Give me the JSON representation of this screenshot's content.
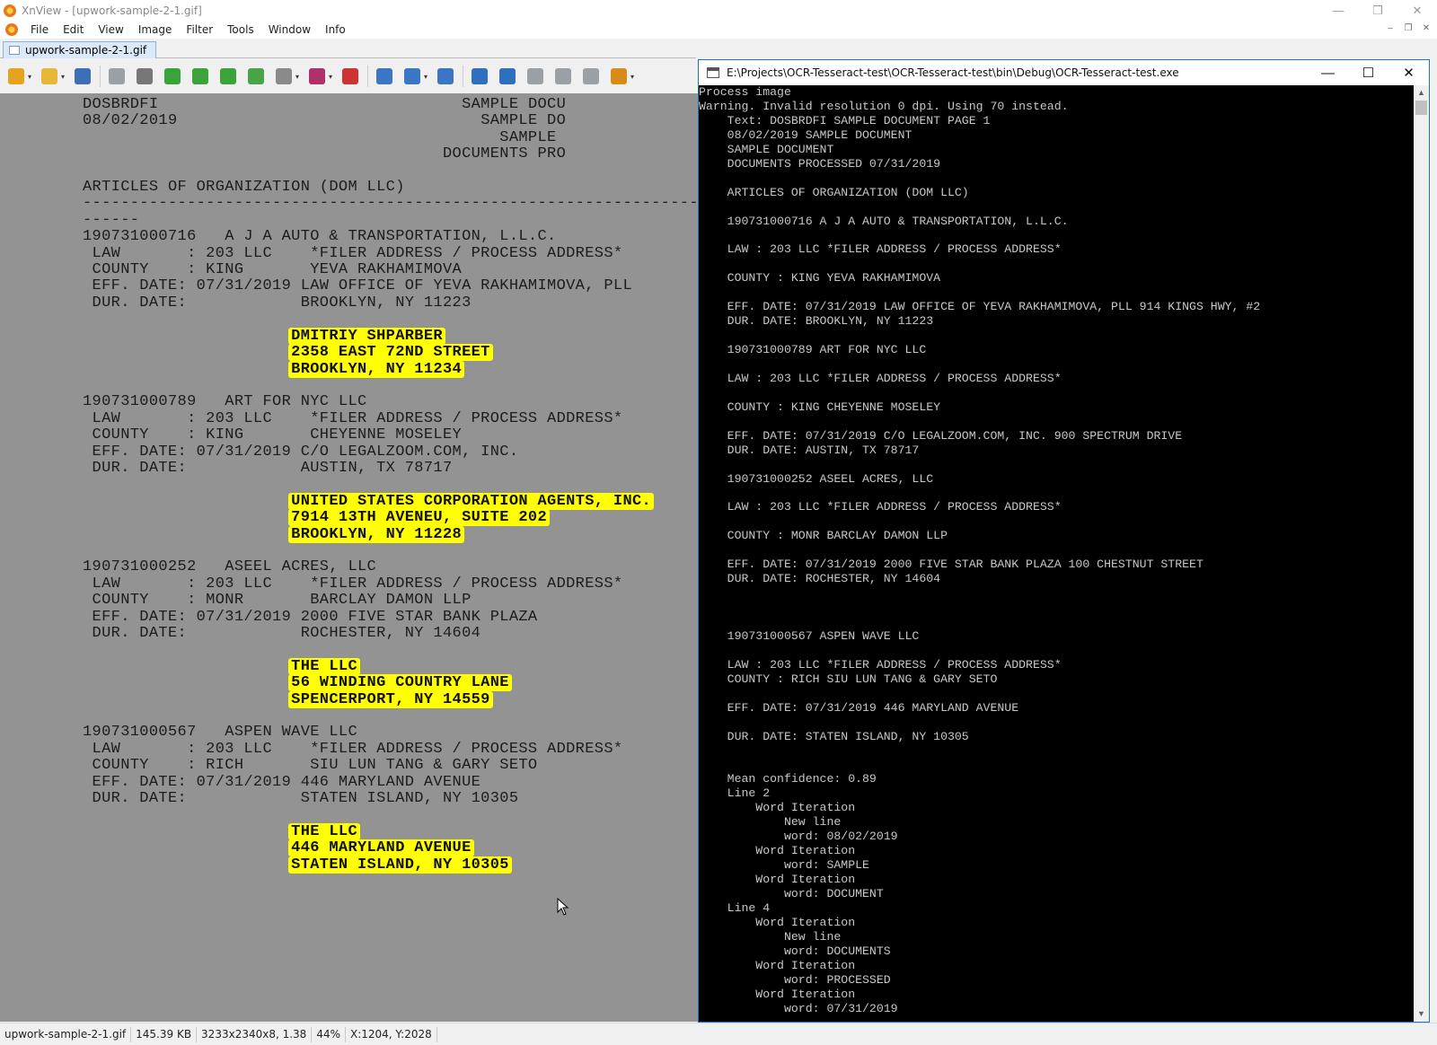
{
  "window": {
    "title": "XnView - [upwork-sample-2-1.gif]",
    "controls": [
      "—",
      "❐",
      "✕"
    ]
  },
  "menu": [
    "File",
    "Edit",
    "View",
    "Image",
    "Filter",
    "Tools",
    "Window",
    "Info"
  ],
  "mdi_controls": [
    "–",
    "❐",
    "✕"
  ],
  "tab": {
    "label": "upwork-sample-2-1.gif"
  },
  "toolbar_icons": [
    {
      "name": "browser-icon",
      "color": "#e9a21f"
    },
    {
      "name": "open-folder-icon",
      "color": "#e7b73a"
    },
    {
      "name": "save-icon",
      "color": "#3d6fb6"
    },
    {
      "name": "undo-icon",
      "color": "#9aa0a6"
    },
    {
      "name": "crop-icon",
      "color": "#777777"
    },
    {
      "name": "rotate-left-icon",
      "color": "#3aa33a"
    },
    {
      "name": "rotate-right-icon",
      "color": "#3aa33a"
    },
    {
      "name": "export-icon",
      "color": "#3aa33a"
    },
    {
      "name": "convert-icon",
      "color": "#48a448"
    },
    {
      "name": "print-icon",
      "color": "#8a8a8a"
    },
    {
      "name": "adjust-icon",
      "color": "#b0306a"
    },
    {
      "name": "effects-icon",
      "color": "#cc3333"
    },
    {
      "name": "zoom-in-icon",
      "color": "#3b76c4"
    },
    {
      "name": "zoom-fit-icon",
      "color": "#3b76c4"
    },
    {
      "name": "zoom-out-icon",
      "color": "#3b76c4"
    },
    {
      "name": "previous-icon",
      "color": "#2f6fc0"
    },
    {
      "name": "next-icon",
      "color": "#2f6fc0"
    },
    {
      "name": "first-icon",
      "color": "#9aa0a6"
    },
    {
      "name": "last-icon",
      "color": "#9aa0a6"
    },
    {
      "name": "fullscreen-icon",
      "color": "#9aa0a6"
    },
    {
      "name": "slideshow-icon",
      "color": "#d98b1a"
    }
  ],
  "document": {
    "header_left": [
      "DOSBRDFI",
      "08/02/2019"
    ],
    "header_right": [
      "SAMPLE DOCU",
      "SAMPLE DO",
      "SAMPLE",
      "DOCUMENTS PRO"
    ],
    "section_title": "ARTICLES OF ORGANIZATION (DOM LLC)",
    "rule_1": "-----------------------------------------------------------------------------",
    "rule_2": "------",
    "entries": [
      {
        "id_line": "190731000716   A J A AUTO & TRANSPORTATION, L.L.C.",
        "law": " LAW       : 203 LLC    *FILER ADDRESS / PROCESS ADDRESS*",
        "county": " COUNTY    : KING       YEVA RAKHAMIMOVA",
        "eff": " EFF. DATE: 07/31/2019 LAW OFFICE OF YEVA RAKHAMIMOVA, PLL",
        "dur": " DUR. DATE:            BROOKLYN, NY 11223",
        "highlight": [
          "DMITRIY SHPARBER",
          "2358 EAST 72ND STREET",
          "BROOKLYN, NY 11234"
        ]
      },
      {
        "id_line": "190731000789   ART FOR NYC LLC",
        "law": " LAW       : 203 LLC    *FILER ADDRESS / PROCESS ADDRESS*",
        "county": " COUNTY    : KING       CHEYENNE MOSELEY",
        "eff": " EFF. DATE: 07/31/2019 C/O LEGALZOOM.COM, INC.",
        "dur": " DUR. DATE:            AUSTIN, TX 78717",
        "highlight": [
          "UNITED STATES CORPORATION AGENTS, INC.",
          "7914 13TH AVENEU, SUITE 202",
          "BROOKLYN, NY 11228"
        ]
      },
      {
        "id_line": "190731000252   ASEEL ACRES, LLC",
        "law": " LAW       : 203 LLC    *FILER ADDRESS / PROCESS ADDRESS*",
        "county": " COUNTY    : MONR       BARCLAY DAMON LLP",
        "eff": " EFF. DATE: 07/31/2019 2000 FIVE STAR BANK PLAZA",
        "dur": " DUR. DATE:            ROCHESTER, NY 14604",
        "highlight": [
          "THE LLC",
          "56 WINDING COUNTRY LANE",
          "SPENCERPORT, NY 14559"
        ]
      },
      {
        "id_line": "190731000567   ASPEN WAVE LLC",
        "law": " LAW       : 203 LLC    *FILER ADDRESS / PROCESS ADDRESS*",
        "county": " COUNTY    : RICH       SIU LUN TANG & GARY SETO",
        "eff": " EFF. DATE: 07/31/2019 446 MARYLAND AVENUE",
        "dur": " DUR. DATE:            STATEN ISLAND, NY 10305",
        "highlight": [
          "THE LLC",
          "446 MARYLAND AVENUE",
          "STATEN ISLAND, NY 10305"
        ]
      }
    ]
  },
  "console": {
    "title": "E:\\Projects\\OCR-Tesseract-test\\OCR-Tesseract-test\\bin\\Debug\\OCR-Tesseract-test.exe",
    "controls": [
      "—",
      "☐",
      "✕"
    ],
    "lines": [
      "Process image",
      "Warning. Invalid resolution 0 dpi. Using 70 instead.",
      "    Text: DOSBRDFI SAMPLE DOCUMENT PAGE 1",
      "    08/02/2019 SAMPLE DOCUMENT",
      "    SAMPLE DOCUMENT",
      "    DOCUMENTS PROCESSED 07/31/2019",
      "",
      "    ARTICLES OF ORGANIZATION (DOM LLC)",
      "",
      "    190731000716 A J A AUTO & TRANSPORTATION, L.L.C.",
      "",
      "    LAW : 203 LLC *FILER ADDRESS / PROCESS ADDRESS*",
      "",
      "    COUNTY : KING YEVA RAKHAMIMOVA",
      "",
      "    EFF. DATE: 07/31/2019 LAW OFFICE OF YEVA RAKHAMIMOVA, PLL 914 KINGS HWY, #2",
      "    DUR. DATE: BROOKLYN, NY 11223",
      "",
      "    190731000789 ART FOR NYC LLC",
      "",
      "    LAW : 203 LLC *FILER ADDRESS / PROCESS ADDRESS*",
      "",
      "    COUNTY : KING CHEYENNE MOSELEY",
      "",
      "    EFF. DATE: 07/31/2019 C/O LEGALZOOM.COM, INC. 900 SPECTRUM DRIVE",
      "    DUR. DATE: AUSTIN, TX 78717",
      "",
      "    190731000252 ASEEL ACRES, LLC",
      "",
      "    LAW : 203 LLC *FILER ADDRESS / PROCESS ADDRESS*",
      "",
      "    COUNTY : MONR BARCLAY DAMON LLP",
      "",
      "    EFF. DATE: 07/31/2019 2000 FIVE STAR BANK PLAZA 100 CHESTNUT STREET",
      "    DUR. DATE: ROCHESTER, NY 14604",
      "",
      "",
      "",
      "    190731000567 ASPEN WAVE LLC",
      "",
      "    LAW : 203 LLC *FILER ADDRESS / PROCESS ADDRESS*",
      "    COUNTY : RICH SIU LUN TANG & GARY SETO",
      "",
      "    EFF. DATE: 07/31/2019 446 MARYLAND AVENUE",
      "",
      "    DUR. DATE: STATEN ISLAND, NY 10305",
      "",
      "",
      "    Mean confidence: 0.89",
      "    Line 2",
      "        Word Iteration",
      "            New line",
      "            word: 08/02/2019",
      "        Word Iteration",
      "            word: SAMPLE",
      "        Word Iteration",
      "            word: DOCUMENT",
      "    Line 4",
      "        Word Iteration",
      "            New line",
      "            word: DOCUMENTS",
      "        Word Iteration",
      "            word: PROCESSED",
      "        Word Iteration",
      "            word: 07/31/2019"
    ]
  },
  "status": {
    "filename": "upwork-sample-2-1.gif",
    "size": "145.39 KB",
    "dimensions": "3233x2340x8, 1.38",
    "zoom": "44%",
    "coords": "X:1204, Y:2028"
  }
}
